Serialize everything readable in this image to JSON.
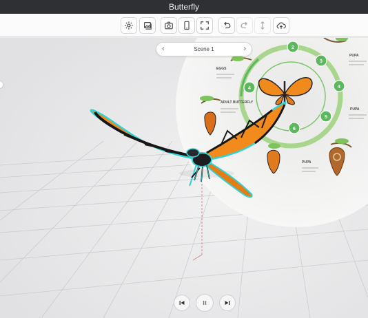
{
  "window": {
    "title": "Butterfly"
  },
  "toolbar": {
    "buttons": [
      {
        "name": "settings",
        "icon": "gear-icon",
        "enabled": true
      },
      {
        "name": "gallery",
        "icon": "image-stack-icon",
        "enabled": true
      },
      {
        "name": "screenshot",
        "icon": "camera-icon",
        "enabled": true
      },
      {
        "name": "device-preview",
        "icon": "phone-icon",
        "enabled": true
      },
      {
        "name": "fullscreen",
        "icon": "expand-icon",
        "enabled": true
      },
      {
        "name": "undo",
        "icon": "undo-icon",
        "enabled": true
      },
      {
        "name": "redo",
        "icon": "redo-icon",
        "enabled": false
      },
      {
        "name": "transform",
        "icon": "move-vertical-icon",
        "enabled": false
      },
      {
        "name": "cloud-upload",
        "icon": "cloud-upload-icon",
        "enabled": true
      }
    ]
  },
  "scene": {
    "label": "Scene 1",
    "prev_icon": "chevron-left-icon",
    "next_icon": "chevron-right-icon"
  },
  "infographic": {
    "stage_labels": [
      "EGGS",
      "ADULT BUTTERFLY",
      "PUPA",
      "PUPA",
      "PUPA"
    ],
    "stage_numbers": [
      "2",
      "3",
      "4",
      "4",
      "5",
      "6"
    ]
  },
  "playback": {
    "prev_icon": "skip-back-icon",
    "pause_icon": "pause-icon",
    "next_icon": "skip-forward-icon"
  },
  "colors": {
    "accent_green": "#5cb85c",
    "selection_outline": "#2fd3d6",
    "wing_orange": "#f08a1c",
    "titlebar": "#2f3034"
  }
}
